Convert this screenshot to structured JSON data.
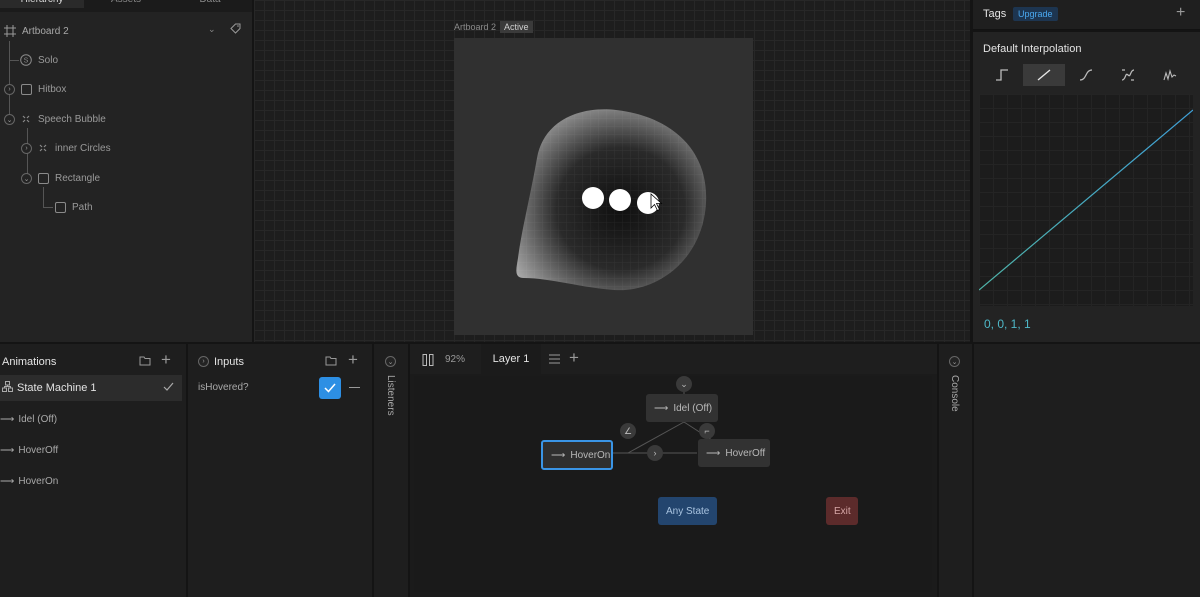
{
  "hierarchy": {
    "tabs": [
      "Hierarchy",
      "Assets",
      "Data"
    ],
    "artboard_label": "Artboard 2",
    "items": [
      {
        "label": "Solo"
      },
      {
        "label": "Hitbox"
      },
      {
        "label": "Speech Bubble"
      },
      {
        "label": "inner Circles"
      },
      {
        "label": "Rectangle"
      },
      {
        "label": "Path"
      }
    ]
  },
  "canvas": {
    "artboard_title": "Artboard 2",
    "artboard_status": "Active"
  },
  "right_panel": {
    "tags_label": "Tags",
    "upgrade_label": "Upgrade",
    "interpolation_title": "Default Interpolation",
    "interpolation_options": [
      "hold",
      "linear",
      "cubic",
      "elastic-cubic",
      "spring"
    ],
    "selected_interpolation": "linear",
    "curve_values": "0, 0, 1, 1",
    "accent_color": "#3fa0d8"
  },
  "animations": {
    "title": "Animations",
    "items": [
      {
        "label": "State Machine 1",
        "selected": true
      },
      {
        "label": "Idel (Off)"
      },
      {
        "label": "HoverOff"
      },
      {
        "label": "HoverOn"
      }
    ]
  },
  "inputs": {
    "title": "Inputs",
    "items": [
      {
        "label": "isHovered?",
        "checked": true
      }
    ]
  },
  "listeners": {
    "title": "Listeners"
  },
  "graph": {
    "zoom": "92%",
    "layer_tab": "Layer 1",
    "states": {
      "idle": "Idel (Off)",
      "hover_on": "HoverOn",
      "hover_off": "HoverOff",
      "any_state": "Any State",
      "exit": "Exit"
    }
  },
  "console": {
    "title": "Console"
  }
}
